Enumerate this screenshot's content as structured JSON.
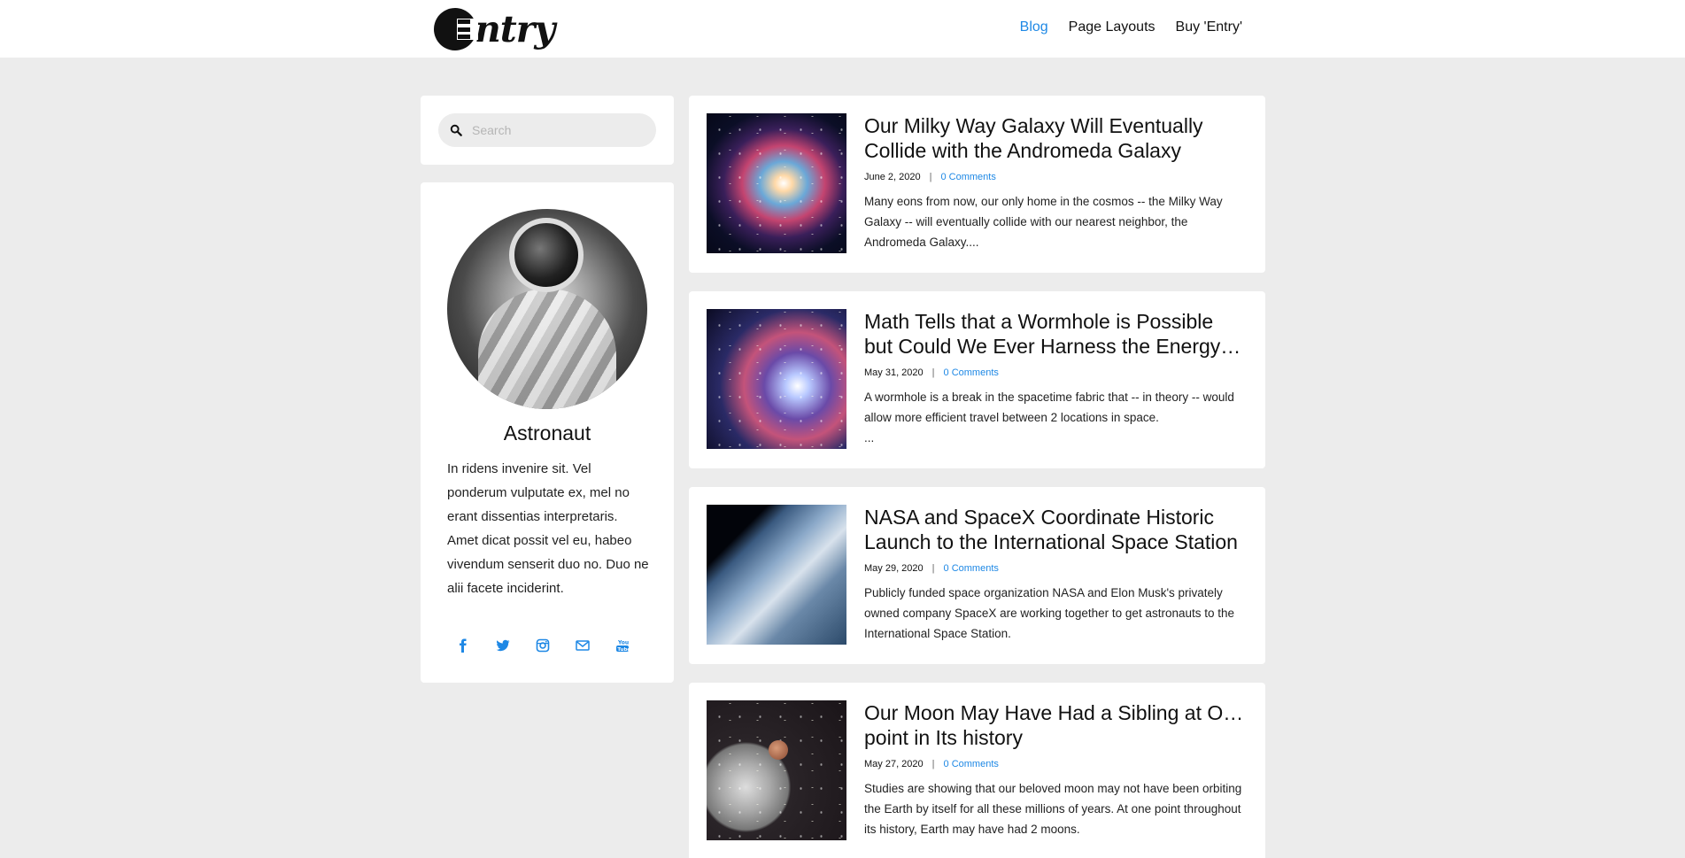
{
  "brand": {
    "name": "ntry"
  },
  "nav": {
    "items": [
      "Blog",
      "Page Layouts",
      "Buy 'Entry'"
    ]
  },
  "search": {
    "placeholder": "Search"
  },
  "profile": {
    "name": "Astronaut",
    "bio": "In ridens invenire sit. Vel ponderum vulputate ex, mel no erant dissentias interpretaris. Amet dicat possit vel eu, habeo vivendum senserit duo no. Duo ne alii facete inciderint.",
    "socials": [
      "facebook-icon",
      "twitter-icon",
      "instagram-icon",
      "mail-icon",
      "youtube-icon"
    ]
  },
  "posts": [
    {
      "title_line1": "Our Milky Way Galaxy Will Eventually",
      "title_line2": "Collide with the Andromeda Galaxy",
      "date": "June 2, 2020",
      "comments": "0 Comments",
      "excerpt": "Many eons from now, our only home in the cosmos -- the Milky Way Galaxy -- will eventually collide with our nearest neighbor, the Andromeda Galaxy...."
    },
    {
      "title_line1": "Math Tells that a Wormhole is Possible",
      "title_line2": "but Could We Ever Harness the Energy t…",
      "date": "May 31, 2020",
      "comments": "0 Comments",
      "excerpt": "A wormhole is a break in the spacetime fabric that -- in theory -- would allow more efficient travel between 2 locations in space.",
      "excerpt_extra": "..."
    },
    {
      "title_line1": "NASA and SpaceX Coordinate Historic",
      "title_line2": "Launch to the International Space Station",
      "date": "May 29, 2020",
      "comments": "0 Comments",
      "excerpt": "Publicly funded space organization NASA and Elon Musk's privately owned company SpaceX are working together to get astronauts to the International Space Station."
    },
    {
      "title_line1": "Our Moon May Have Had a Sibling at One",
      "title_line2": "point in Its history",
      "date": "May 27, 2020",
      "comments": "0 Comments",
      "excerpt": "Studies are showing that our beloved moon may not have been orbiting the Earth by itself for all these millions of years. At one point throughout its history, Earth may have had 2 moons."
    }
  ],
  "colors": {
    "accent": "#1e88e5",
    "page_bg": "#ececec",
    "card_bg": "#ffffff"
  }
}
